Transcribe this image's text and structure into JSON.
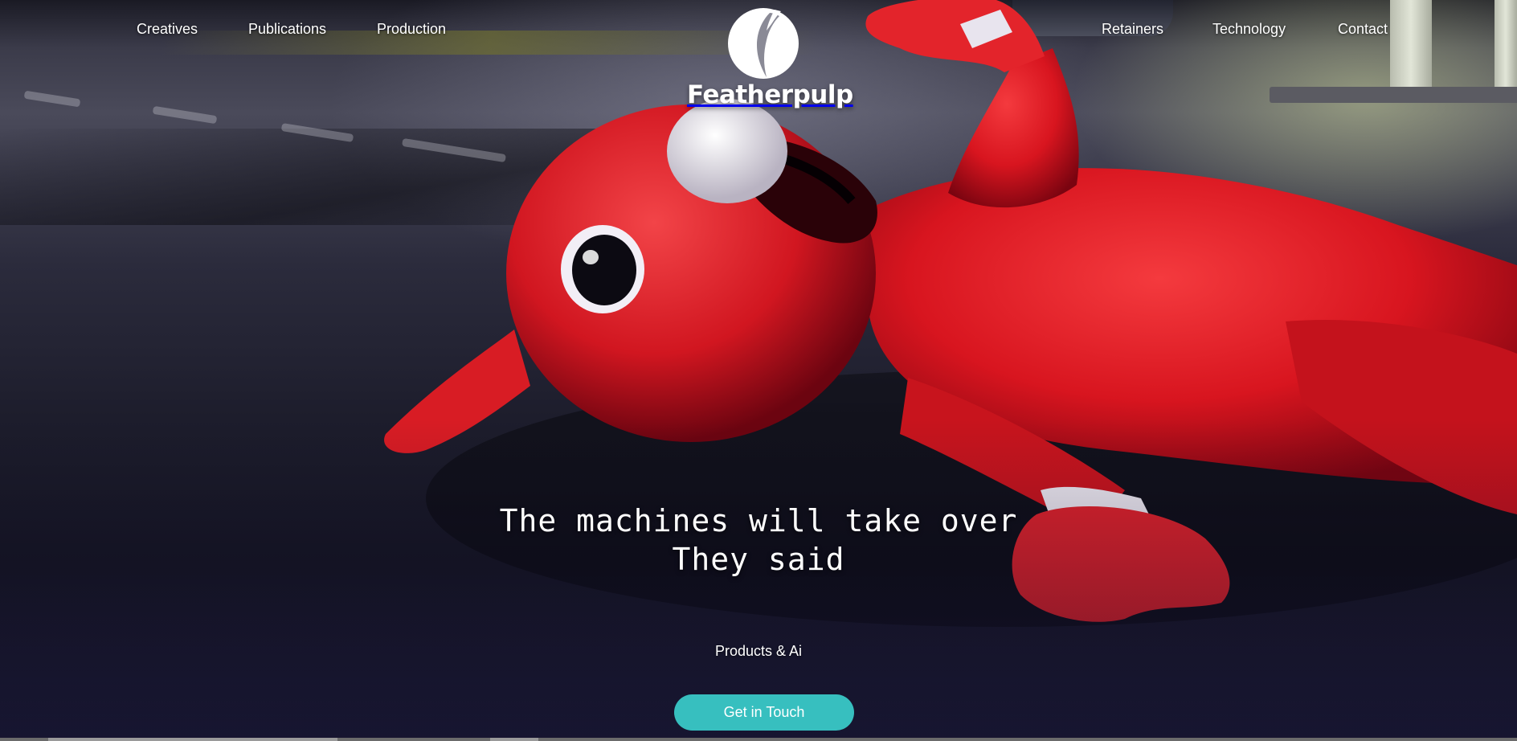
{
  "nav": {
    "left": [
      "Creatives",
      "Publications",
      "Production"
    ],
    "right": [
      "Retainers",
      "Technology",
      "Contact"
    ]
  },
  "brand": {
    "name": "Featherpulp"
  },
  "hero": {
    "headline_line1": "The machines will take over",
    "headline_line2": "They said",
    "tagline": "Products & Ai",
    "cta_label": "Get in Touch"
  },
  "colors": {
    "accent": "#37bfbf",
    "figure_red": "#e0202a",
    "text": "#ffffff"
  },
  "icons": {
    "logo": "feather-logo-icon"
  }
}
